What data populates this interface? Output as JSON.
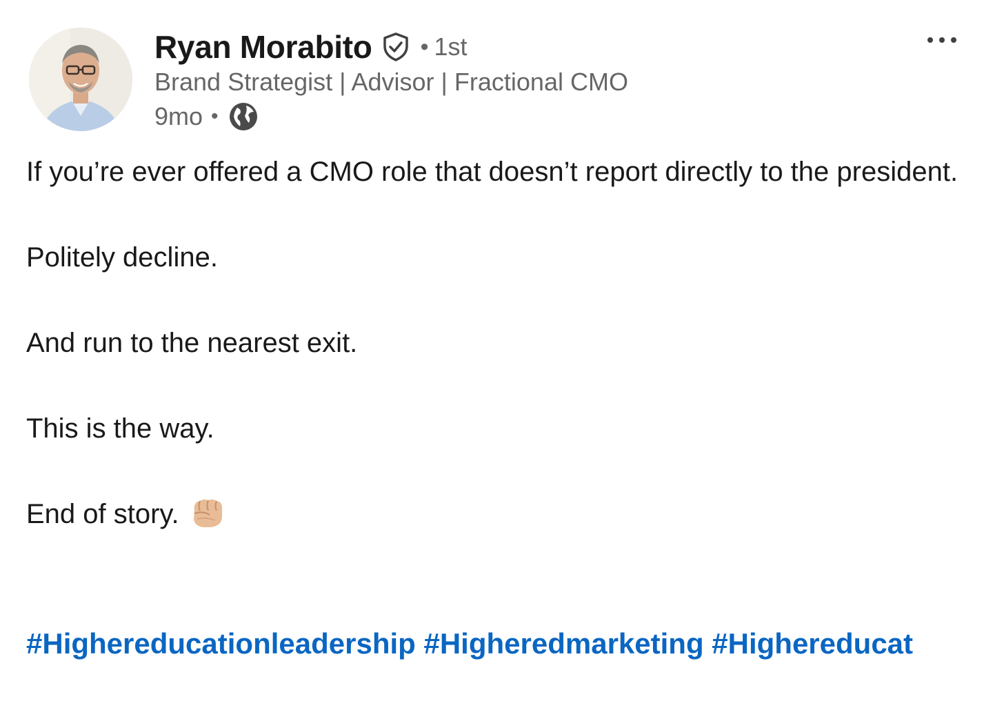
{
  "author": {
    "name": "Ryan Morabito",
    "connection_degree": "1st",
    "headline": "Brand Strategist | Advisor | Fractional CMO",
    "post_age": "9mo",
    "separator": "•"
  },
  "icons": {
    "verified": "verified-shield-icon",
    "visibility": "globe-icon",
    "more": "more-options-icon",
    "emoji": "fist-emoji-icon"
  },
  "post": {
    "lines": [
      "If you’re ever offered a CMO role that doesn’t report directly to the president.",
      "Politely decline.",
      "And run to the nearest exit.",
      "This is the way.",
      "End of story."
    ],
    "hashtags": [
      "#Highereducationleadership",
      "#Higheredmarketing",
      "#Highereducat"
    ]
  },
  "colors": {
    "text": "#191919",
    "secondary_text": "#666666",
    "link": "#0a66c2"
  }
}
